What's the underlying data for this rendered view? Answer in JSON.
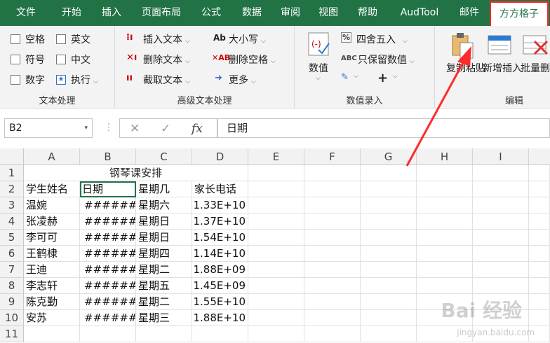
{
  "tabs": [
    {
      "label": "文件",
      "active": false
    },
    {
      "label": "开始",
      "active": false
    },
    {
      "label": "插入",
      "active": false
    },
    {
      "label": "页面布局",
      "active": false
    },
    {
      "label": "公式",
      "active": false
    },
    {
      "label": "数据",
      "active": false
    },
    {
      "label": "审阅",
      "active": false
    },
    {
      "label": "视图",
      "active": false
    },
    {
      "label": "帮助",
      "active": false
    },
    {
      "label": "AudTool",
      "active": false
    },
    {
      "label": "邮件",
      "active": false
    },
    {
      "label": "方方格子",
      "active": true
    }
  ],
  "ribbon": {
    "text_processing": {
      "label": "文本处理",
      "checks": [
        "空格",
        "英文",
        "符号",
        "中文",
        "数字"
      ],
      "exec": "执行"
    },
    "advanced_text": {
      "label": "高级文本处理",
      "insert": "插入文本",
      "delete": "删除文本",
      "extract": "截取文本",
      "case": "大小写",
      "remove_spaces": "删除空格",
      "more": "更多"
    },
    "numeric": {
      "label": "数值录入",
      "value": "数值",
      "round": "四舍五入",
      "keep_value": "只保留数值",
      "plus": "+"
    },
    "edit": {
      "label": "编辑",
      "copy_paste": "复制粘贴",
      "insert_new": "新增插入",
      "batch_delete": "批量删除"
    }
  },
  "formula_bar": {
    "name_box": "B2",
    "content": "日期",
    "cancel": "✕",
    "enter": "✓",
    "fx": "fx"
  },
  "sheet": {
    "columns": [
      "A",
      "B",
      "C",
      "D",
      "E",
      "F",
      "G",
      "H",
      "I"
    ],
    "title": "钢琴课安排",
    "headers": [
      "学生姓名",
      "日期",
      "星期几",
      "家长电话"
    ],
    "rows": [
      [
        "温婉",
        "######",
        "星期六",
        "1.33E+10"
      ],
      [
        "张凌赫",
        "######",
        "星期日",
        "1.37E+10"
      ],
      [
        "李可可",
        "######",
        "星期日",
        "1.54E+10"
      ],
      [
        "王鹤棣",
        "######",
        "星期四",
        "1.14E+10"
      ],
      [
        "王迪",
        "######",
        "星期二",
        "1.88E+09"
      ],
      [
        "李志轩",
        "######",
        "星期五",
        "1.45E+09"
      ],
      [
        "陈克勤",
        "######",
        "星期二",
        "1.55E+10"
      ],
      [
        "安苏",
        "######",
        "星期三",
        "1.88E+10"
      ]
    ],
    "row_numbers": [
      "1",
      "2",
      "3",
      "4",
      "5",
      "6",
      "7",
      "8",
      "9",
      "10",
      "11"
    ]
  },
  "watermark": {
    "main": "Bai 经验",
    "sub": "jingyan.baidu.com"
  },
  "colors": {
    "ribbon_green": "#217346",
    "highlight_red": "#ff2a2a"
  }
}
